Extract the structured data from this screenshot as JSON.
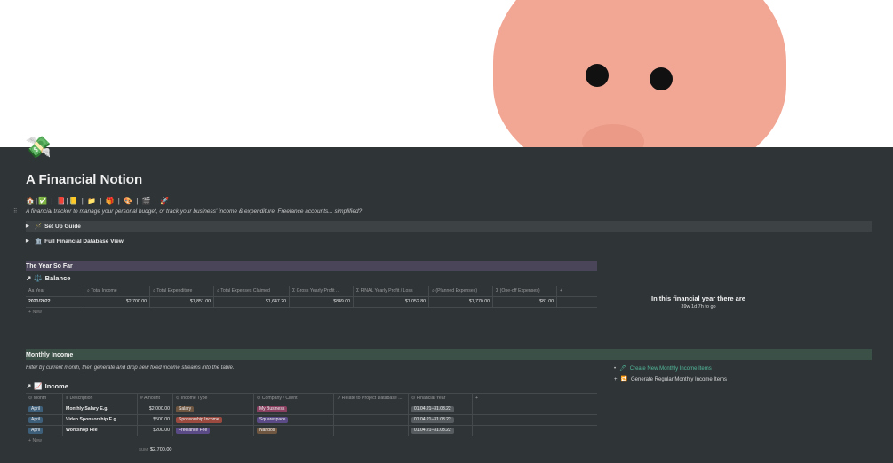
{
  "page": {
    "title": "A Financial Notion",
    "icon": "money-wings-icon",
    "emoji_row": "🏠|✅ | 📕|📒 | 📁 | 🎁 | 🎨 | 🎬 | 🚀",
    "description": "A financial tracker to manage your personal budget, or track your business' income & expenditure. Freelance accounts... simplified?"
  },
  "toggles": [
    {
      "label": "Set Up Guide",
      "icon": "wand-icon"
    },
    {
      "label": "Full Financial Database View",
      "icon": "bank-icon"
    }
  ],
  "year_section": {
    "heading": "The Year So Far",
    "db_title": "Balance",
    "columns": [
      "Year",
      "Total Income",
      "Total Expenditure",
      "Total Expenses Claimed",
      "Gross Yearly Profit ...",
      "FINAL Yearly Profit / Loss",
      "(Planned Expenses)",
      "(One-off Expenses)"
    ],
    "rows": [
      [
        "2021/2022",
        "$2,700.00",
        "$1,851.00",
        "$1,647.20",
        "$849.00",
        "$1,052.80",
        "$1,770.00",
        "$81.00"
      ]
    ],
    "new_label": "New"
  },
  "countdown": {
    "title": "In this financial year there are",
    "value": "39w 1d 7h to go"
  },
  "monthly_section": {
    "heading": "Monthly Income",
    "filter_text": "Filter by current month, then generate and drop new fixed income streams into the table.",
    "links": [
      {
        "label": "Create New Monthly Income Items"
      },
      {
        "label": "Generate Regular Monthly Income Items"
      }
    ],
    "db_title": "Income",
    "columns": [
      "Month",
      "Description",
      "Amount",
      "Income Type",
      "Company / Client",
      "Relate to Project Database ...",
      "Financial Year"
    ],
    "rows": [
      {
        "month": "April",
        "description": "Monthly Salary E.g.",
        "amount": "$2,000.00",
        "type": "Salary",
        "client": "My Business",
        "project": "",
        "year": "01.04.21–31.03.22"
      },
      {
        "month": "April",
        "description": "Video Sponsorship E.g.",
        "amount": "$500.00",
        "type": "Sponsorship Income",
        "client": "Squarespace",
        "project": "",
        "year": "01.04.21–31.03.22"
      },
      {
        "month": "April",
        "description": "Workshop Fee",
        "amount": "$200.00",
        "type": "Freelance Fee",
        "client": "Nandos",
        "project": "",
        "year": "01.04.21–31.03.22"
      }
    ],
    "new_label": "New",
    "sum_label": "SUM",
    "sum_value": "$2,700.00"
  }
}
